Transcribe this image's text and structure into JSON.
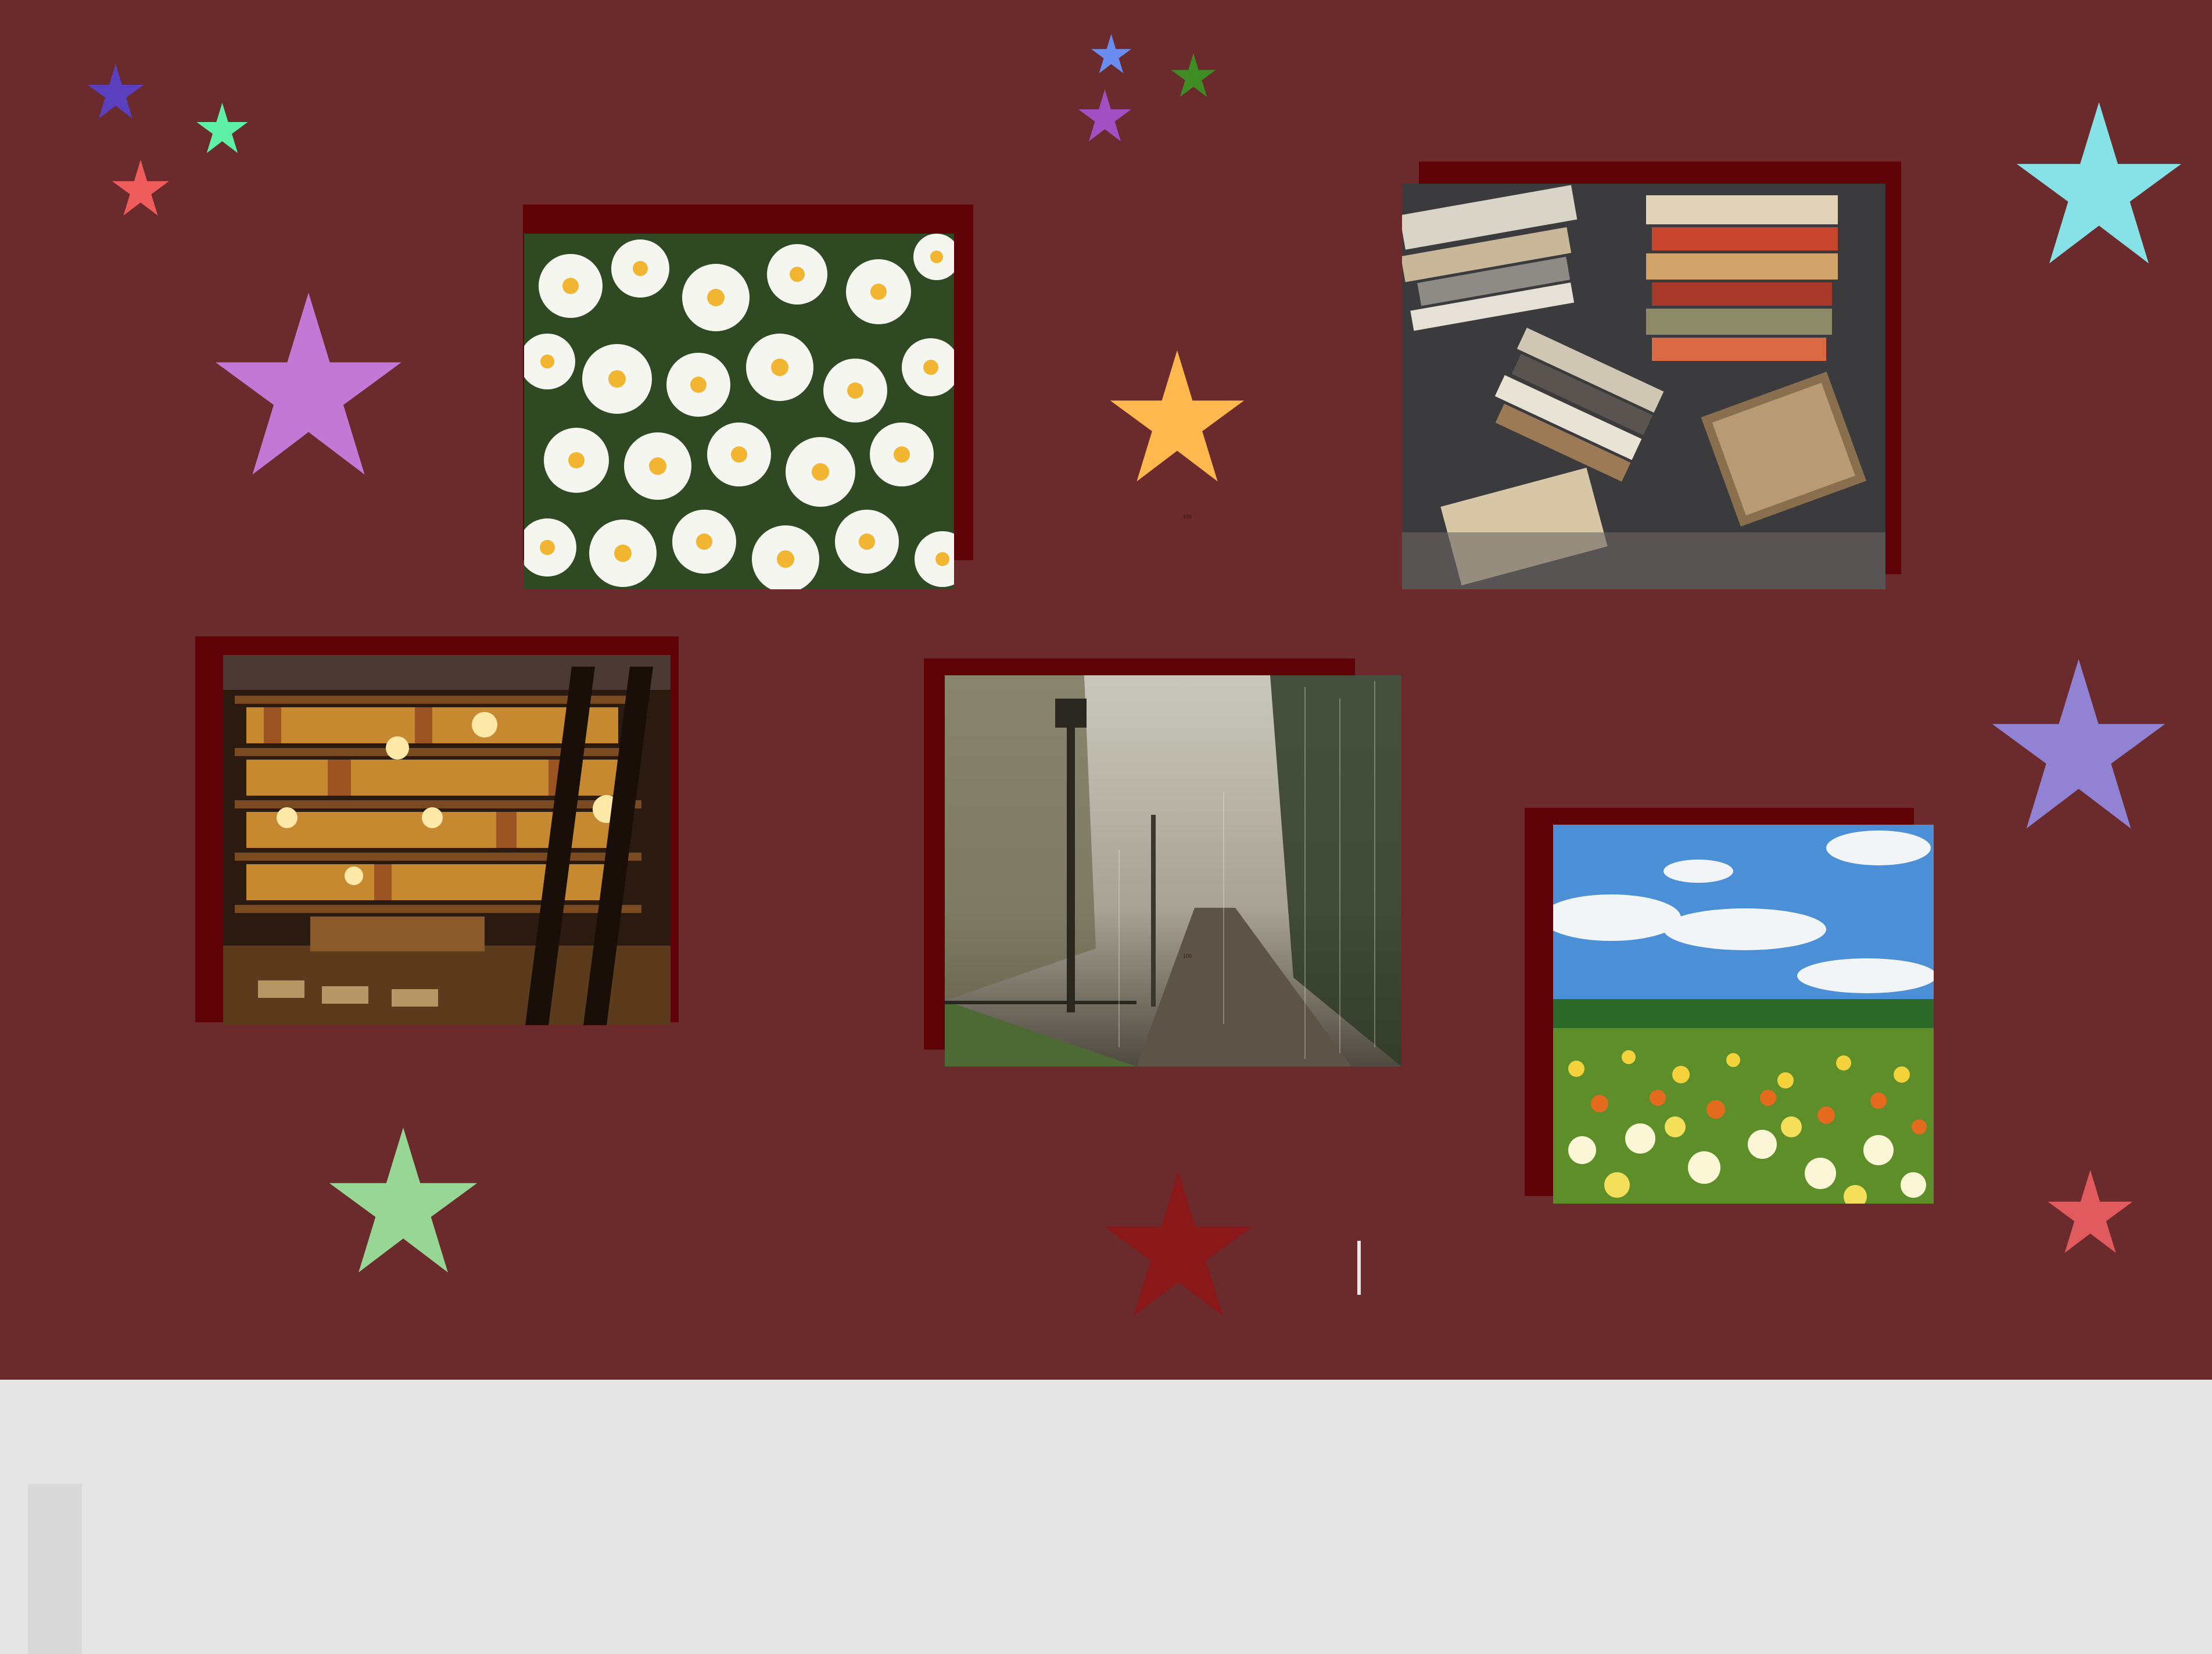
{
  "slide": {
    "background": "#6b2a2c",
    "backing_color": "#5e0208"
  },
  "stars": [
    {
      "name": "star-indigo-small",
      "color": "#5a3fbf"
    },
    {
      "name": "star-mint-small",
      "color": "#5ef0a6"
    },
    {
      "name": "star-coral-small",
      "color": "#ee5c5c"
    },
    {
      "name": "star-orchid-large",
      "color": "#c478d6"
    },
    {
      "name": "star-blue-tiny",
      "color": "#6b8cf0"
    },
    {
      "name": "star-green-tiny",
      "color": "#3e8c24"
    },
    {
      "name": "star-purple-tiny",
      "color": "#a24fc4"
    },
    {
      "name": "star-amber-medium",
      "color": "#ffb84d"
    },
    {
      "name": "star-cyan-large",
      "color": "#86e2e6"
    },
    {
      "name": "star-lavender-large",
      "color": "#9182d4"
    },
    {
      "name": "star-sage-medium",
      "color": "#97d695"
    },
    {
      "name": "star-crimson-large",
      "color": "#8a1818"
    },
    {
      "name": "star-rose-small",
      "color": "#e05a5e"
    }
  ],
  "photos": [
    {
      "name": "daisies-photo"
    },
    {
      "name": "book-stacks-photo"
    },
    {
      "name": "library-photo"
    },
    {
      "name": "rainy-path-photo"
    },
    {
      "name": "poppy-field-photo"
    }
  ],
  "labels": {
    "small_marker_a": "100",
    "small_marker_b": "100"
  }
}
